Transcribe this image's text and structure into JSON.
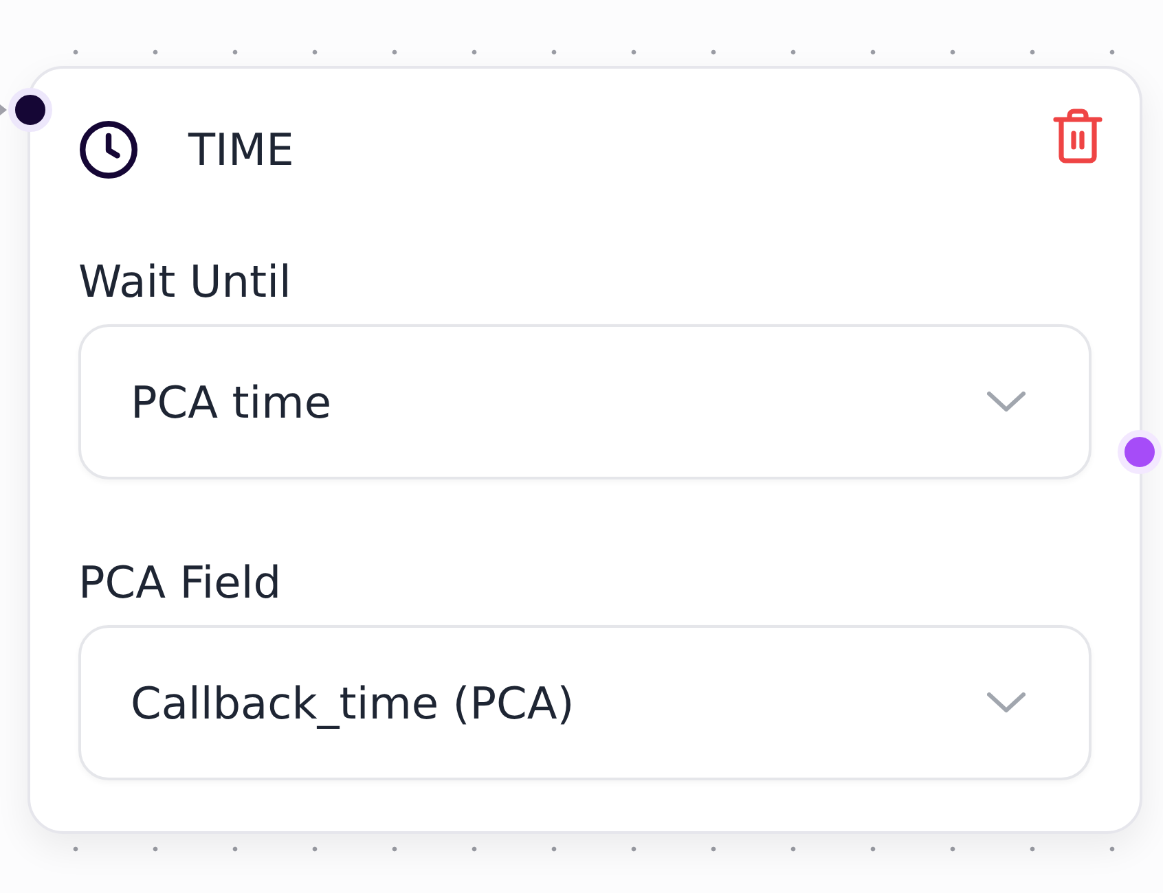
{
  "node": {
    "title": "TIME",
    "handles": [
      {
        "kind": "input",
        "color": "#150635"
      },
      {
        "kind": "output",
        "color": "#a64cf8"
      }
    ],
    "fields": [
      {
        "label": "Wait Until",
        "value": "PCA time"
      },
      {
        "label": "PCA Field",
        "value": "Callback_time (PCA)"
      }
    ]
  }
}
